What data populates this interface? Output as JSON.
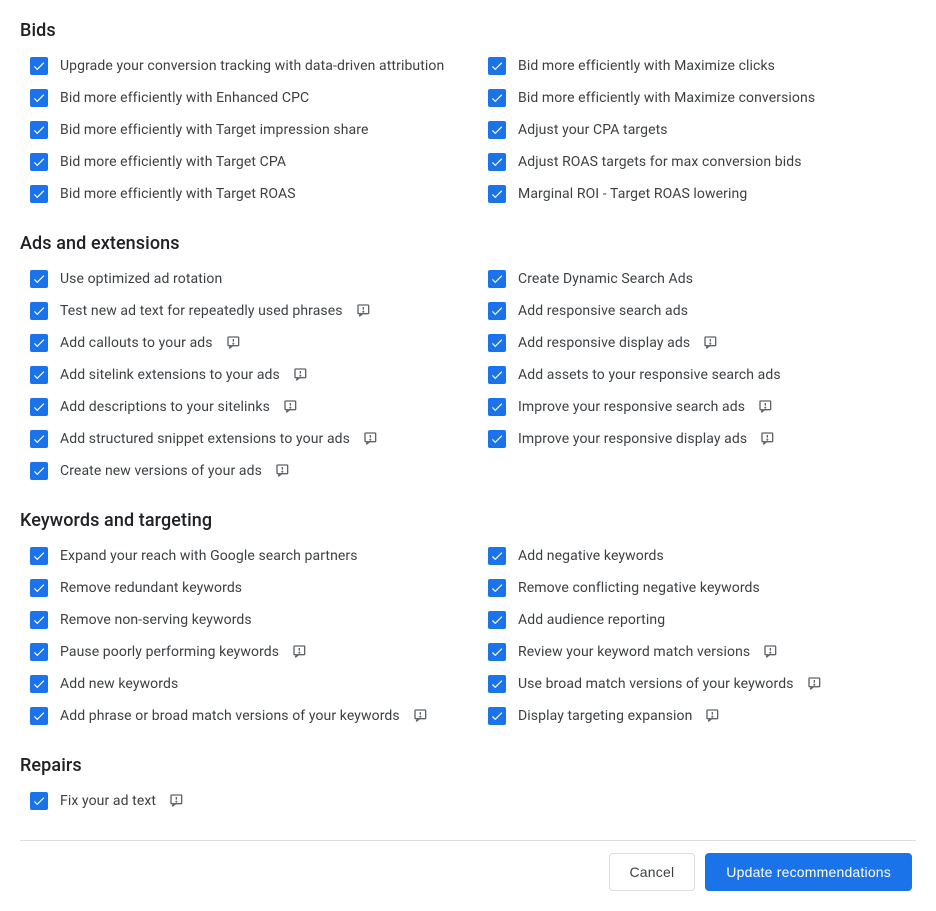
{
  "sections": [
    {
      "title": "Bids",
      "left": [
        {
          "label": "Upgrade your conversion tracking with data-driven attribution",
          "alert": false
        },
        {
          "label": "Bid more efficiently with Enhanced CPC",
          "alert": false
        },
        {
          "label": "Bid more efficiently with Target impression share",
          "alert": false
        },
        {
          "label": "Bid more efficiently with Target CPA",
          "alert": false
        },
        {
          "label": "Bid more efficiently with Target ROAS",
          "alert": false
        }
      ],
      "right": [
        {
          "label": "Bid more efficiently with Maximize clicks",
          "alert": false
        },
        {
          "label": "Bid more efficiently with Maximize conversions",
          "alert": false
        },
        {
          "label": "Adjust your CPA targets",
          "alert": false
        },
        {
          "label": "Adjust ROAS targets for max conversion bids",
          "alert": false
        },
        {
          "label": "Marginal ROI - Target ROAS lowering",
          "alert": false
        }
      ]
    },
    {
      "title": "Ads and extensions",
      "left": [
        {
          "label": "Use optimized ad rotation",
          "alert": false
        },
        {
          "label": "Test new ad text for repeatedly used phrases",
          "alert": true
        },
        {
          "label": "Add callouts to your ads",
          "alert": true
        },
        {
          "label": "Add sitelink extensions to your ads",
          "alert": true
        },
        {
          "label": "Add descriptions to your sitelinks",
          "alert": true
        },
        {
          "label": "Add structured snippet extensions to your ads",
          "alert": true
        },
        {
          "label": "Create new versions of your ads",
          "alert": true
        }
      ],
      "right": [
        {
          "label": "Create Dynamic Search Ads",
          "alert": false
        },
        {
          "label": "Add responsive search ads",
          "alert": false
        },
        {
          "label": "Add responsive display ads",
          "alert": true
        },
        {
          "label": "Add assets to your responsive search ads",
          "alert": false
        },
        {
          "label": "Improve your responsive search ads",
          "alert": true
        },
        {
          "label": "Improve your responsive display ads",
          "alert": true
        }
      ]
    },
    {
      "title": "Keywords and targeting",
      "left": [
        {
          "label": "Expand your reach with Google search partners",
          "alert": false
        },
        {
          "label": "Remove redundant keywords",
          "alert": false
        },
        {
          "label": "Remove non-serving keywords",
          "alert": false
        },
        {
          "label": "Pause poorly performing keywords",
          "alert": true
        },
        {
          "label": "Add new keywords",
          "alert": false
        },
        {
          "label": "Add phrase or broad match versions of your keywords",
          "alert": true
        }
      ],
      "right": [
        {
          "label": "Add negative keywords",
          "alert": false
        },
        {
          "label": "Remove conflicting negative keywords",
          "alert": false
        },
        {
          "label": "Add audience reporting",
          "alert": false
        },
        {
          "label": "Review your keyword match versions",
          "alert": true
        },
        {
          "label": "Use broad match versions of your keywords",
          "alert": true
        },
        {
          "label": "Display targeting expansion",
          "alert": true
        }
      ]
    },
    {
      "title": "Repairs",
      "left": [
        {
          "label": "Fix your ad text",
          "alert": true
        }
      ],
      "right": []
    }
  ],
  "footer": {
    "cancel": "Cancel",
    "update": "Update recommendations"
  }
}
